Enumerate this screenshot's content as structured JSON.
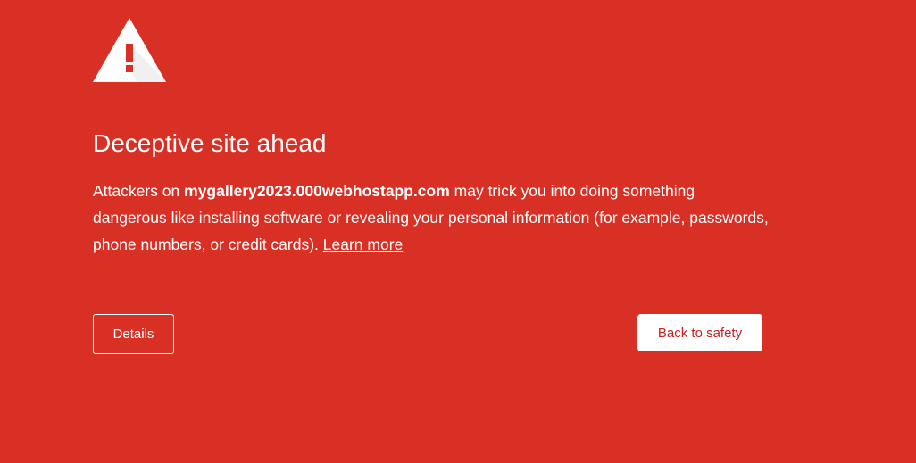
{
  "page": {
    "background_color": "#d93025",
    "accent_text_color": "#c5221f"
  },
  "icon": {
    "name": "warning-triangle-icon"
  },
  "title": "Deceptive site ahead",
  "message": {
    "prefix": "Attackers on ",
    "site": "mygallery2023.000webhostapp.com",
    "body": " may trick you into doing something dangerous like installing software or revealing your personal information (for example, passwords, phone numbers, or credit cards). ",
    "learn_more": "Learn more"
  },
  "buttons": {
    "details_label": "Details",
    "back_to_safety_label": "Back to safety"
  }
}
